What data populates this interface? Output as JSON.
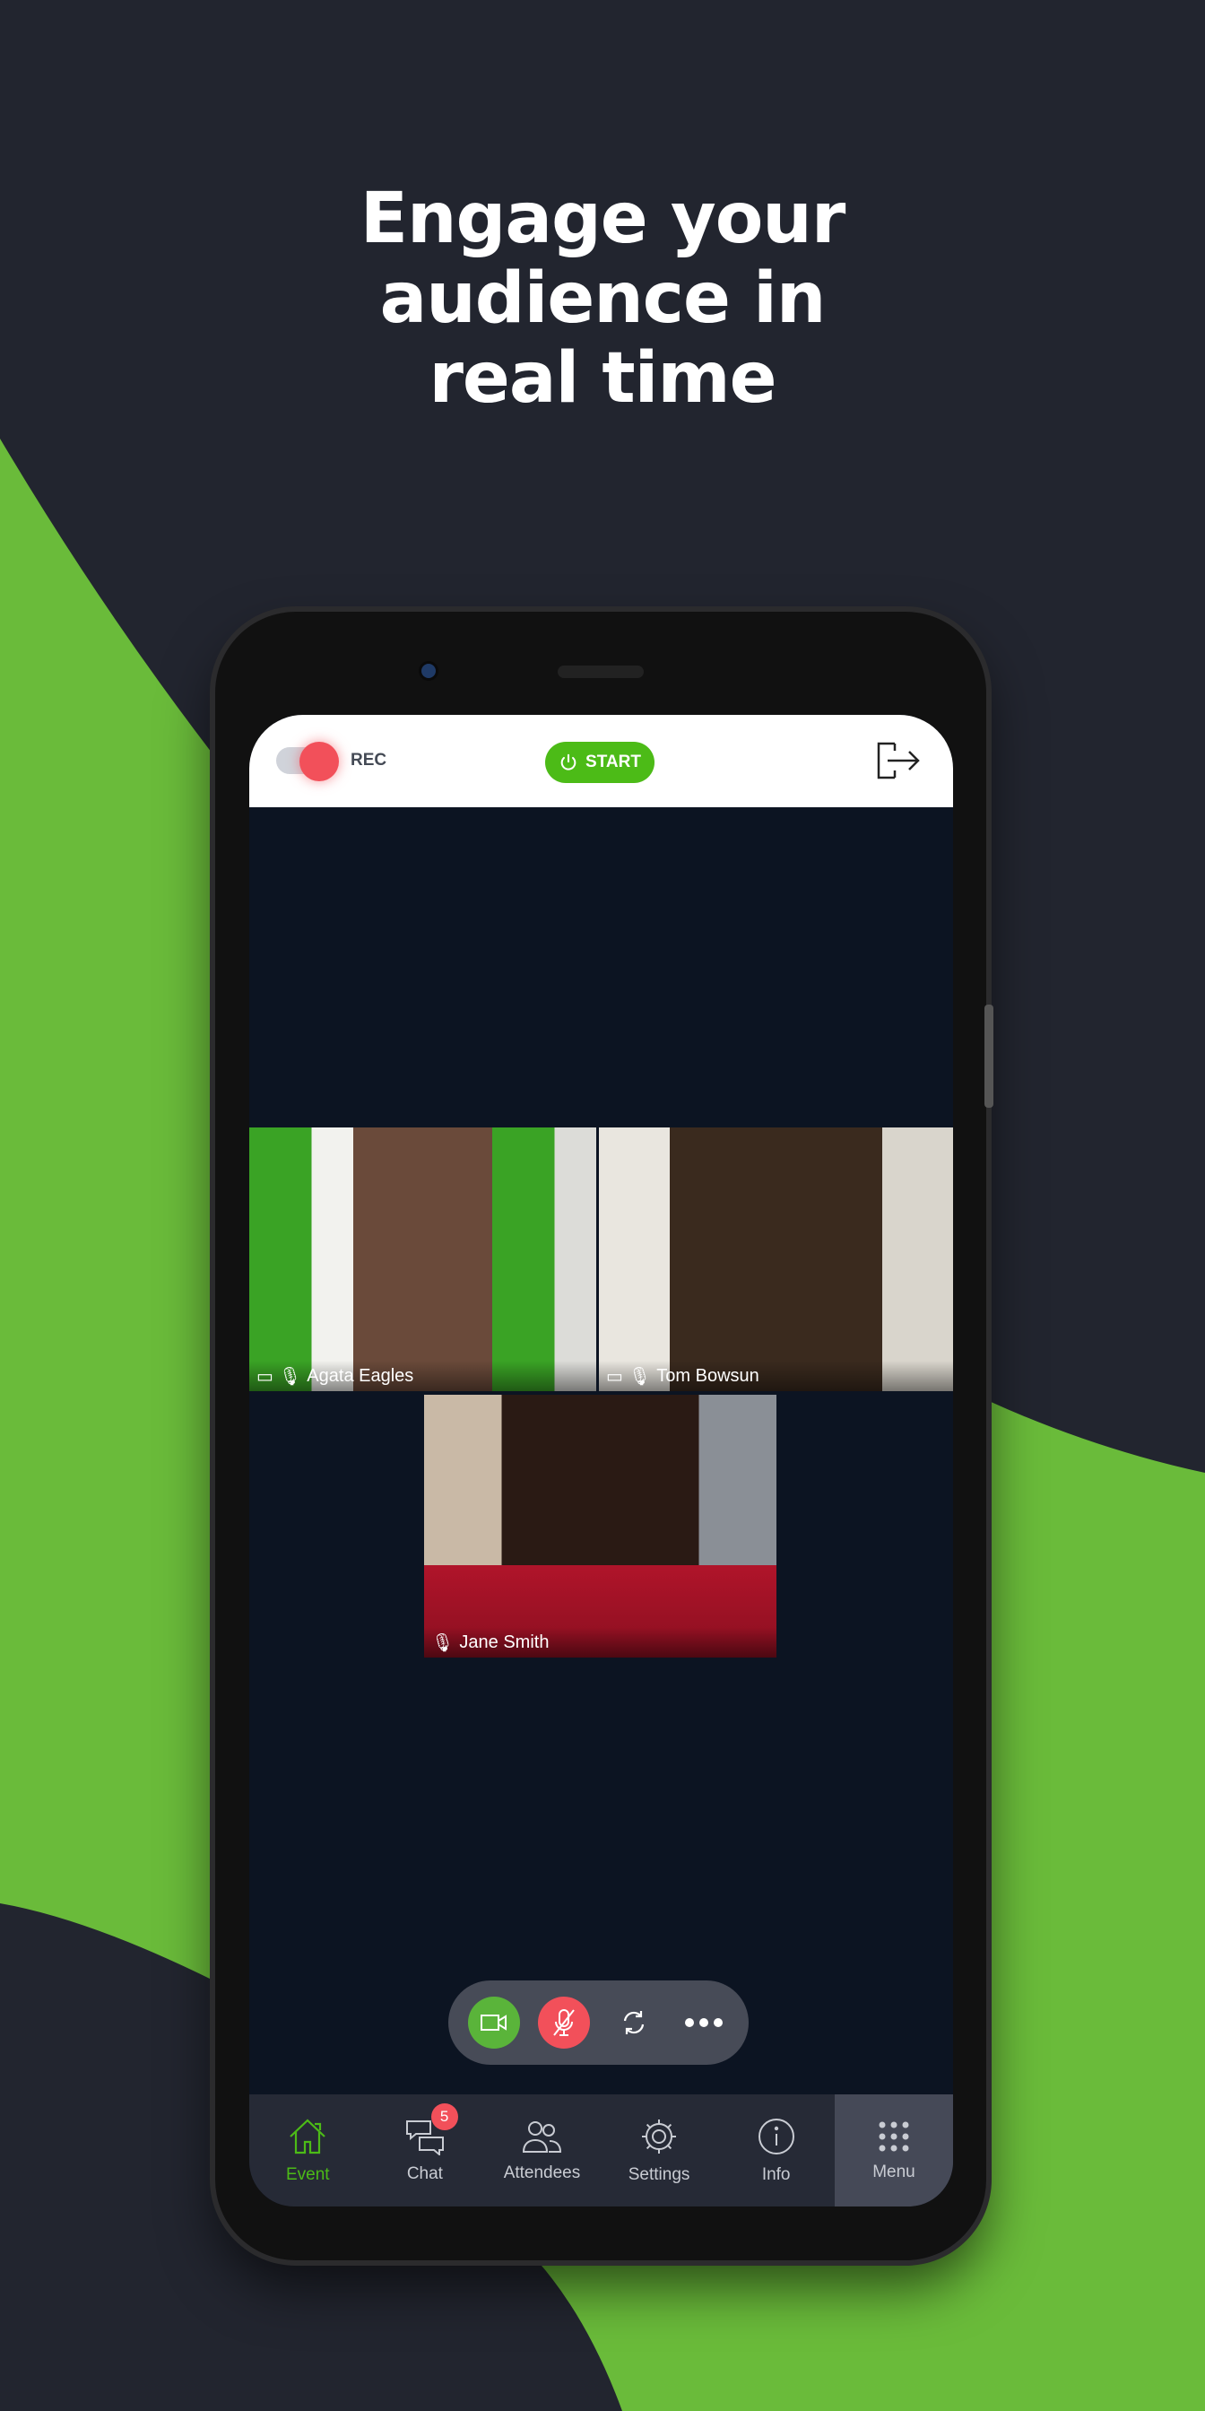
{
  "headline": {
    "line1": "Engage your",
    "line2": "audience in",
    "line3": "real time"
  },
  "colors": {
    "brand_green": "#6abb3a",
    "background": "#22252f",
    "accent_red": "#f2505a",
    "button_green": "#4cbb17"
  },
  "topbar": {
    "rec_label": "REC",
    "start_label": "START",
    "exit_icon": "exit-icon"
  },
  "participants": [
    {
      "name": "Agata Eagles",
      "camera": true,
      "mic": true
    },
    {
      "name": "Tom Bowsun",
      "camera": true,
      "mic": true
    },
    {
      "name": "Jane Smith",
      "camera": false,
      "mic": true
    }
  ],
  "controls": {
    "camera": "on",
    "mic": "muted",
    "icons": [
      "video-camera-icon",
      "mic-off-icon",
      "switch-camera-icon",
      "more-icon"
    ]
  },
  "nav": {
    "items": [
      {
        "label": "Event",
        "icon": "home-icon",
        "active": true
      },
      {
        "label": "Chat",
        "icon": "chat-icon",
        "badge": "5"
      },
      {
        "label": "Attendees",
        "icon": "attendees-icon"
      },
      {
        "label": "Settings",
        "icon": "gear-icon"
      },
      {
        "label": "Info",
        "icon": "info-icon"
      },
      {
        "label": "Menu",
        "icon": "grid-icon"
      }
    ]
  }
}
